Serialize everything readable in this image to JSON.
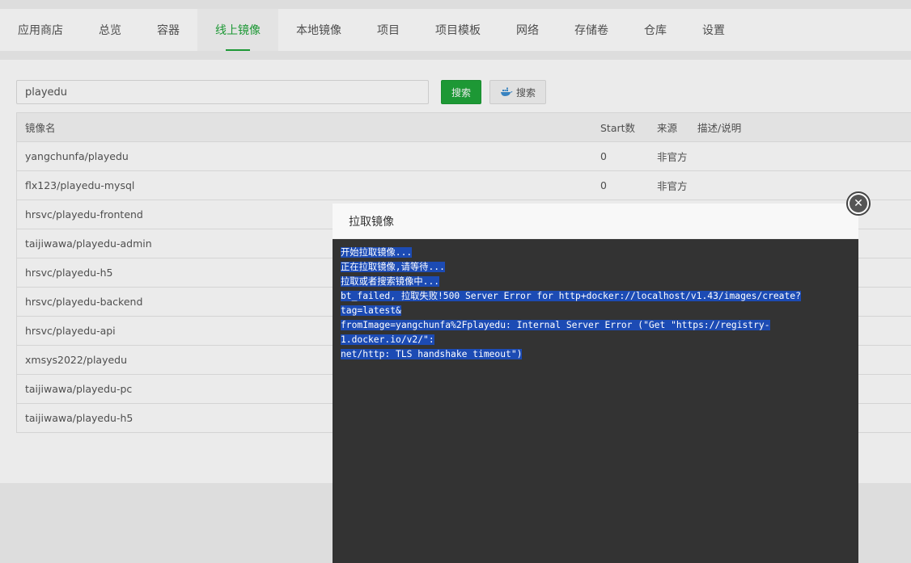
{
  "nav": {
    "tabs": [
      {
        "label": "应用商店"
      },
      {
        "label": "总览"
      },
      {
        "label": "容器"
      },
      {
        "label": "线上镜像",
        "active": true
      },
      {
        "label": "本地镜像"
      },
      {
        "label": "项目"
      },
      {
        "label": "项目模板"
      },
      {
        "label": "网络"
      },
      {
        "label": "存储卷"
      },
      {
        "label": "仓库"
      },
      {
        "label": "设置"
      }
    ]
  },
  "search": {
    "value": "playedu",
    "button_label": "搜索",
    "docker_button_label": "搜索"
  },
  "table": {
    "headers": [
      "镜像名",
      "Start数",
      "来源",
      "描述/说明"
    ],
    "rows": [
      {
        "name": "yangchunfa/playedu",
        "stars": "0",
        "source": "非官方"
      },
      {
        "name": "flx123/playedu-mysql",
        "stars": "0",
        "source": "非官方"
      },
      {
        "name": "hrsvc/playedu-frontend"
      },
      {
        "name": "taijiwawa/playedu-admin"
      },
      {
        "name": "hrsvc/playedu-h5"
      },
      {
        "name": "hrsvc/playedu-backend"
      },
      {
        "name": "hrsvc/playedu-api"
      },
      {
        "name": "xmsys2022/playedu"
      },
      {
        "name": "taijiwawa/playedu-pc"
      },
      {
        "name": "taijiwawa/playedu-h5"
      }
    ]
  },
  "modal": {
    "title": "拉取镜像",
    "lines": [
      "开始拉取镜像...",
      "正在拉取镜像,请等待...",
      "拉取或者搜索镜像中...",
      "bt_failed, 拉取失败!500 Server Error for http+docker://localhost/v1.43/images/create?tag=latest&",
      "fromImage=yangchunfa%2Fplayedu: Internal Server Error (\"Get \"https://registry-1.docker.io/v2/\":",
      "net/http: TLS handshake timeout\")"
    ]
  },
  "colors": {
    "accent": "#20a53a",
    "console_bg": "#333333",
    "selection": "#1c4bb4"
  }
}
